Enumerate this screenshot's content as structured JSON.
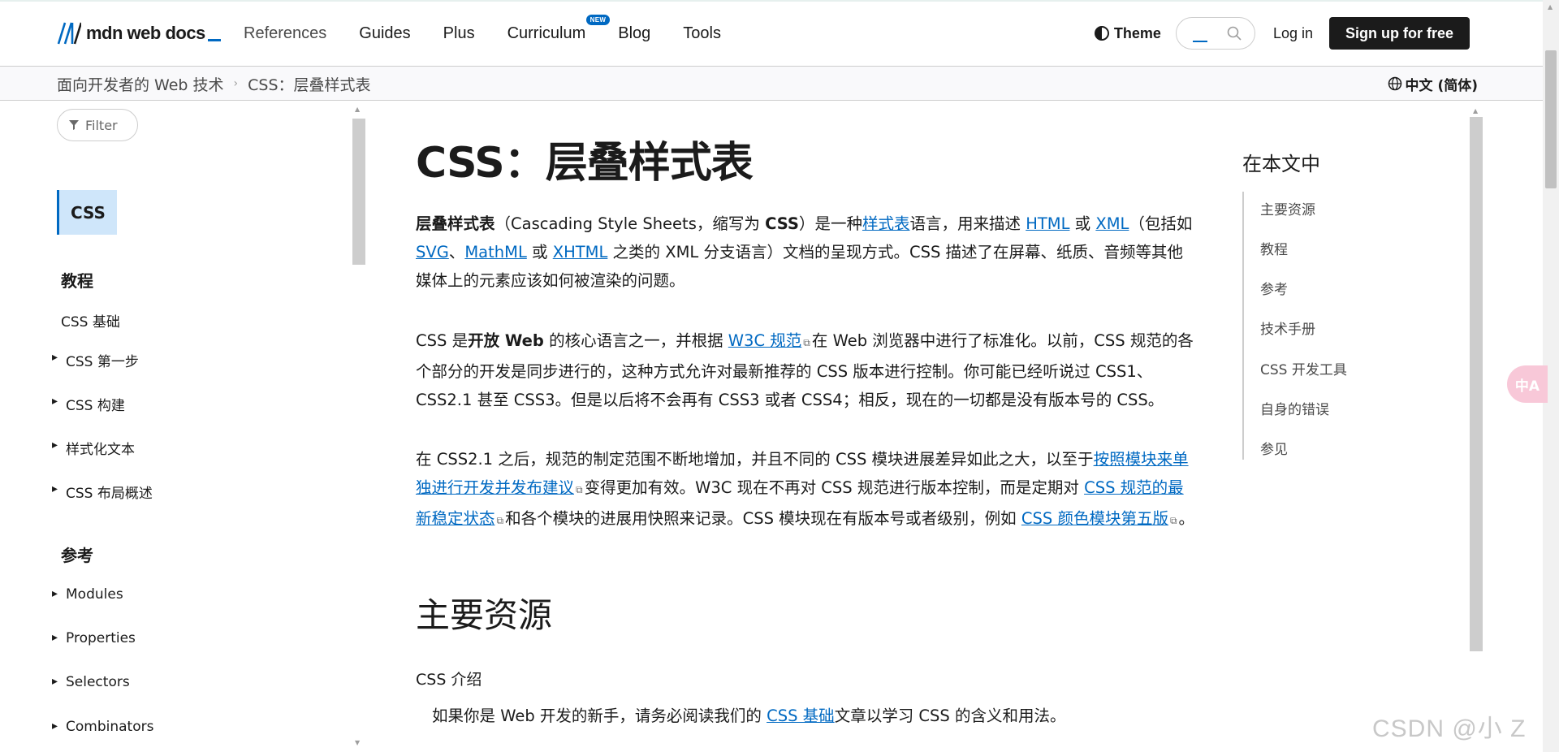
{
  "header": {
    "logo_text": "mdn web docs",
    "nav": [
      {
        "label": "References"
      },
      {
        "label": "Guides"
      },
      {
        "label": "Plus"
      },
      {
        "label": "Curriculum",
        "badge": "NEW"
      },
      {
        "label": "Blog"
      },
      {
        "label": "Tools"
      }
    ],
    "theme_label": "Theme",
    "login_label": "Log in",
    "signup_label": "Sign up for free"
  },
  "breadcrumb": {
    "items": [
      "面向开发者的 Web 技术",
      "CSS：层叠样式表"
    ],
    "separator": "›",
    "language": "中文 (简体)"
  },
  "sidebar": {
    "filter_label": "Filter",
    "active_label": "CSS",
    "sections": [
      {
        "heading": "教程",
        "items": [
          {
            "label": "CSS 基础",
            "expandable": false
          },
          {
            "label": "CSS 第一步",
            "expandable": true
          },
          {
            "label": "CSS 构建",
            "expandable": true
          },
          {
            "label": "样式化文本",
            "expandable": true
          },
          {
            "label": "CSS 布局概述",
            "expandable": true
          }
        ]
      },
      {
        "heading": "参考",
        "items": [
          {
            "label": "Modules",
            "expandable": true
          },
          {
            "label": "Properties",
            "expandable": true
          },
          {
            "label": "Selectors",
            "expandable": true
          },
          {
            "label": "Combinators",
            "expandable": true
          }
        ]
      }
    ]
  },
  "article": {
    "title": "CSS：层叠样式表",
    "p1": {
      "bold_term": "层叠样式表",
      "t1": "（Cascading Style Sheets，缩写为 ",
      "bold_css": "CSS",
      "t2": "）是一种",
      "link_stylesheet": "样式表",
      "t3": "语言，用来描述 ",
      "link_html": "HTML",
      "t4": " 或 ",
      "link_xml": "XML",
      "t5": "（包括如 ",
      "link_svg": "SVG",
      "t6": "、",
      "link_mathml": "MathML",
      "t7": " 或 ",
      "link_xhtml": "XHTML",
      "t8": " 之类的 XML 分支语言）文档的呈现方式。CSS 描述了在屏幕、纸质、音频等其他媒体上的元素应该如何被渲染的问题。"
    },
    "p2": {
      "t1": "CSS 是",
      "bold_open": "开放 Web",
      "t2": " 的核心语言之一，并根据 ",
      "link_w3c": "W3C 规范",
      "t3": "在 Web 浏览器中进行了标准化。以前，CSS 规范的各个部分的开发是同步进行的，这种方式允许对最新推荐的 CSS 版本进行控制。你可能已经听说过 CSS1、CSS2.1 甚至 CSS3。但是以后将不会再有 CSS3 或者 CSS4；相反，现在的一切都是没有版本号的 CSS。"
    },
    "p3": {
      "t1": "在 CSS2.1 之后，规范的制定范围不断地增加，并且不同的 CSS 模块进展差异如此之大，以至于",
      "link_modules": "按照模块来单独进行开发并发布建议",
      "t2": "变得更加有效。W3C 现在不再对 CSS 规范进行版本控制，而是定期对 ",
      "link_snapshot": "CSS 规范的最新稳定状态",
      "t3": "和各个模块的进展用快照来记录。CSS 模块现在有版本号或者级别，例如 ",
      "link_color": "CSS 颜色模块第五版",
      "t4": "。"
    },
    "h2": "主要资源",
    "sub_heading": "CSS 介绍",
    "indent": {
      "t1": "如果你是 Web 开发的新手，请务必阅读我们的 ",
      "link_basics": "CSS 基础",
      "t2": "文章以学习 CSS 的含义和用法。"
    }
  },
  "toc": {
    "title": "在本文中",
    "items": [
      "主要资源",
      "教程",
      "参考",
      "技术手册",
      "CSS 开发工具",
      "自身的错误",
      "参见"
    ]
  },
  "floating_button": {
    "label": "中A"
  },
  "watermark": "CSDN @小 Z",
  "colors": {
    "link": "#0069c2",
    "active_bg": "#cfe6fa",
    "signup_bg": "#1b1b1b",
    "float_btn": "#f8c8d8"
  }
}
